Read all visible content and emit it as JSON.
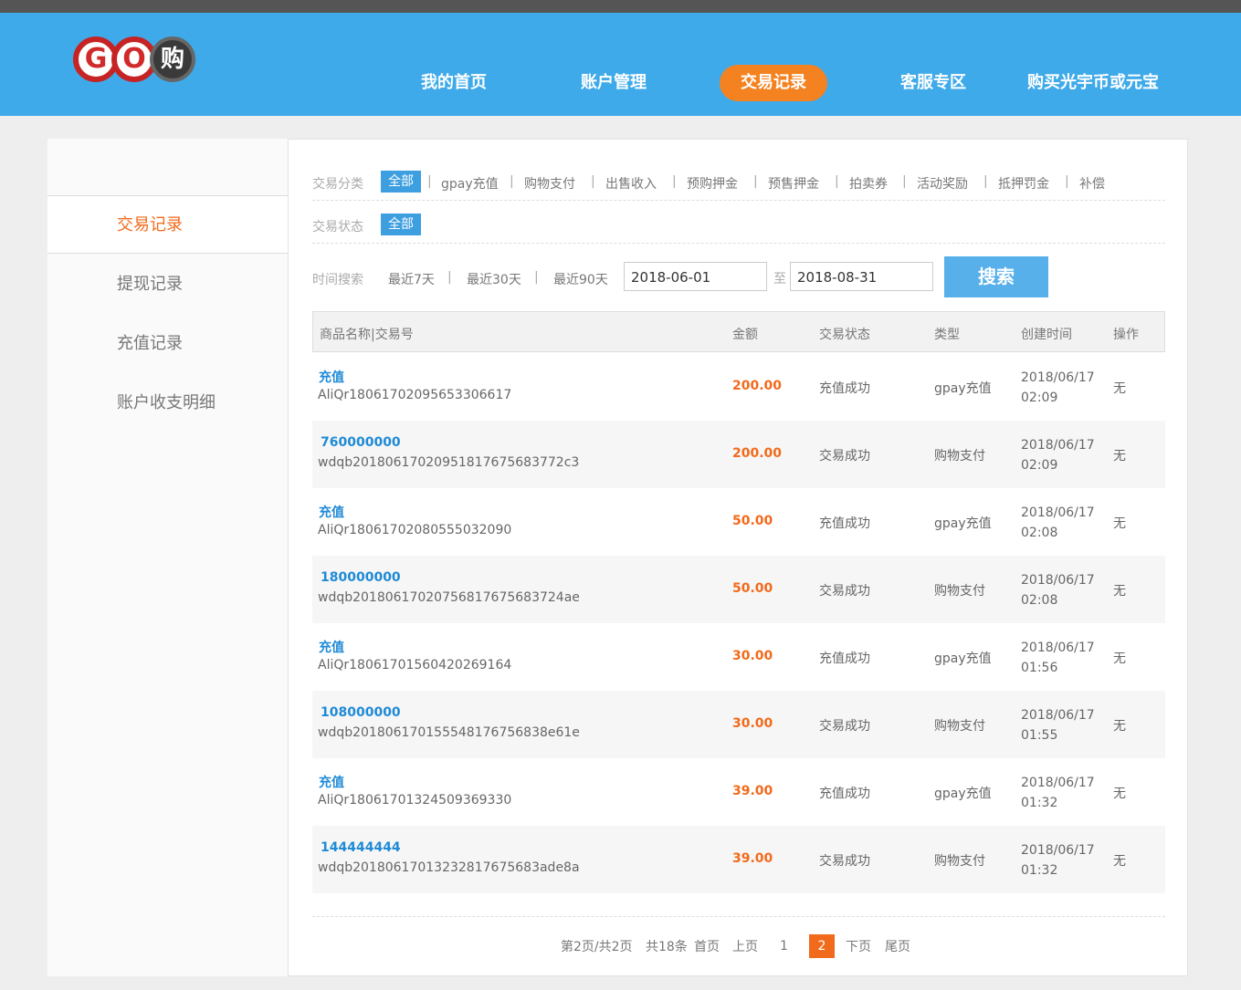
{
  "nav": [
    "我的首页",
    "账户管理",
    "交易记录",
    "客服专区",
    "购买光宇币或元宝"
  ],
  "logo": {
    "g": "G",
    "o": "O",
    "k": "购"
  },
  "sidebar": [
    "交易记录",
    "提现记录",
    "充值记录",
    "账户收支明细"
  ],
  "filters": {
    "category_label": "交易分类",
    "category_options": [
      "全部",
      "gpay充值",
      "购物支付",
      "出售收入",
      "预购押金",
      "预售押金",
      "拍卖券",
      "活动奖励",
      "抵押罚金",
      "补偿"
    ],
    "status_label": "交易状态",
    "status_options": [
      "全部"
    ],
    "time_label": "时间搜索",
    "time_options": [
      "最近7天",
      "最近30天",
      "最近90天"
    ],
    "date_from": "2018-06-01",
    "date_to_sep": "至",
    "date_to": "2018-08-31",
    "search_label": "搜索",
    "separator": "|"
  },
  "table": {
    "headers": [
      "商品名称|交易号",
      "金额",
      "交易状态",
      "类型",
      "创建时间",
      "操作"
    ],
    "rows": [
      {
        "name": "充值",
        "txid": "AliQr18061702095653306617",
        "amount": "200.00",
        "status": "充值成功",
        "type": "gpay充值",
        "date": "2018/06/17",
        "time": "02:09",
        "op": "无"
      },
      {
        "name": "760000000",
        "txid": "wdqb201806170209518176756837 72c3",
        "amount": "200.00",
        "status": "交易成功",
        "type": "购物支付",
        "date": "2018/06/17",
        "time": "02:09",
        "op": "无"
      },
      {
        "name": "充值",
        "txid": "AliQr18061702080555032090",
        "amount": "50.00",
        "status": "充值成功",
        "type": "gpay充值",
        "date": "2018/06/17",
        "time": "02:08",
        "op": "无"
      },
      {
        "name": "180000000",
        "txid": "wdqb2018061702075681767568 3724ae",
        "amount": "50.00",
        "status": "交易成功",
        "type": "购物支付",
        "date": "2018/06/17",
        "time": "02:08",
        "op": "无"
      },
      {
        "name": "充值",
        "txid": "AliQr18061701560420269164",
        "amount": "30.00",
        "status": "充值成功",
        "type": "gpay充值",
        "date": "2018/06/17",
        "time": "01:56",
        "op": "无"
      },
      {
        "name": "108000000",
        "txid": "wdqb2018061701555481767568 38e61e",
        "amount": "30.00",
        "status": "交易成功",
        "type": "购物支付",
        "date": "2018/06/17",
        "time": "01:55",
        "op": "无"
      },
      {
        "name": "充值",
        "txid": "AliQr18061701324509369330",
        "amount": "39.00",
        "status": "充值成功",
        "type": "gpay充值",
        "date": "2018/06/17",
        "time": "01:32",
        "op": "无"
      },
      {
        "name": "144444444",
        "txid": "wdqb2018061701323281767568 3ade8a",
        "amount": "39.00",
        "status": "交易成功",
        "type": "购物支付",
        "date": "2018/06/17",
        "time": "01:32",
        "op": "无"
      }
    ]
  },
  "pager": {
    "summary": "第2页/共2页",
    "total": "共18条",
    "first": "首页",
    "prev": "上页",
    "page1": "1",
    "page2": "2",
    "next": "下页",
    "last": "尾页"
  }
}
